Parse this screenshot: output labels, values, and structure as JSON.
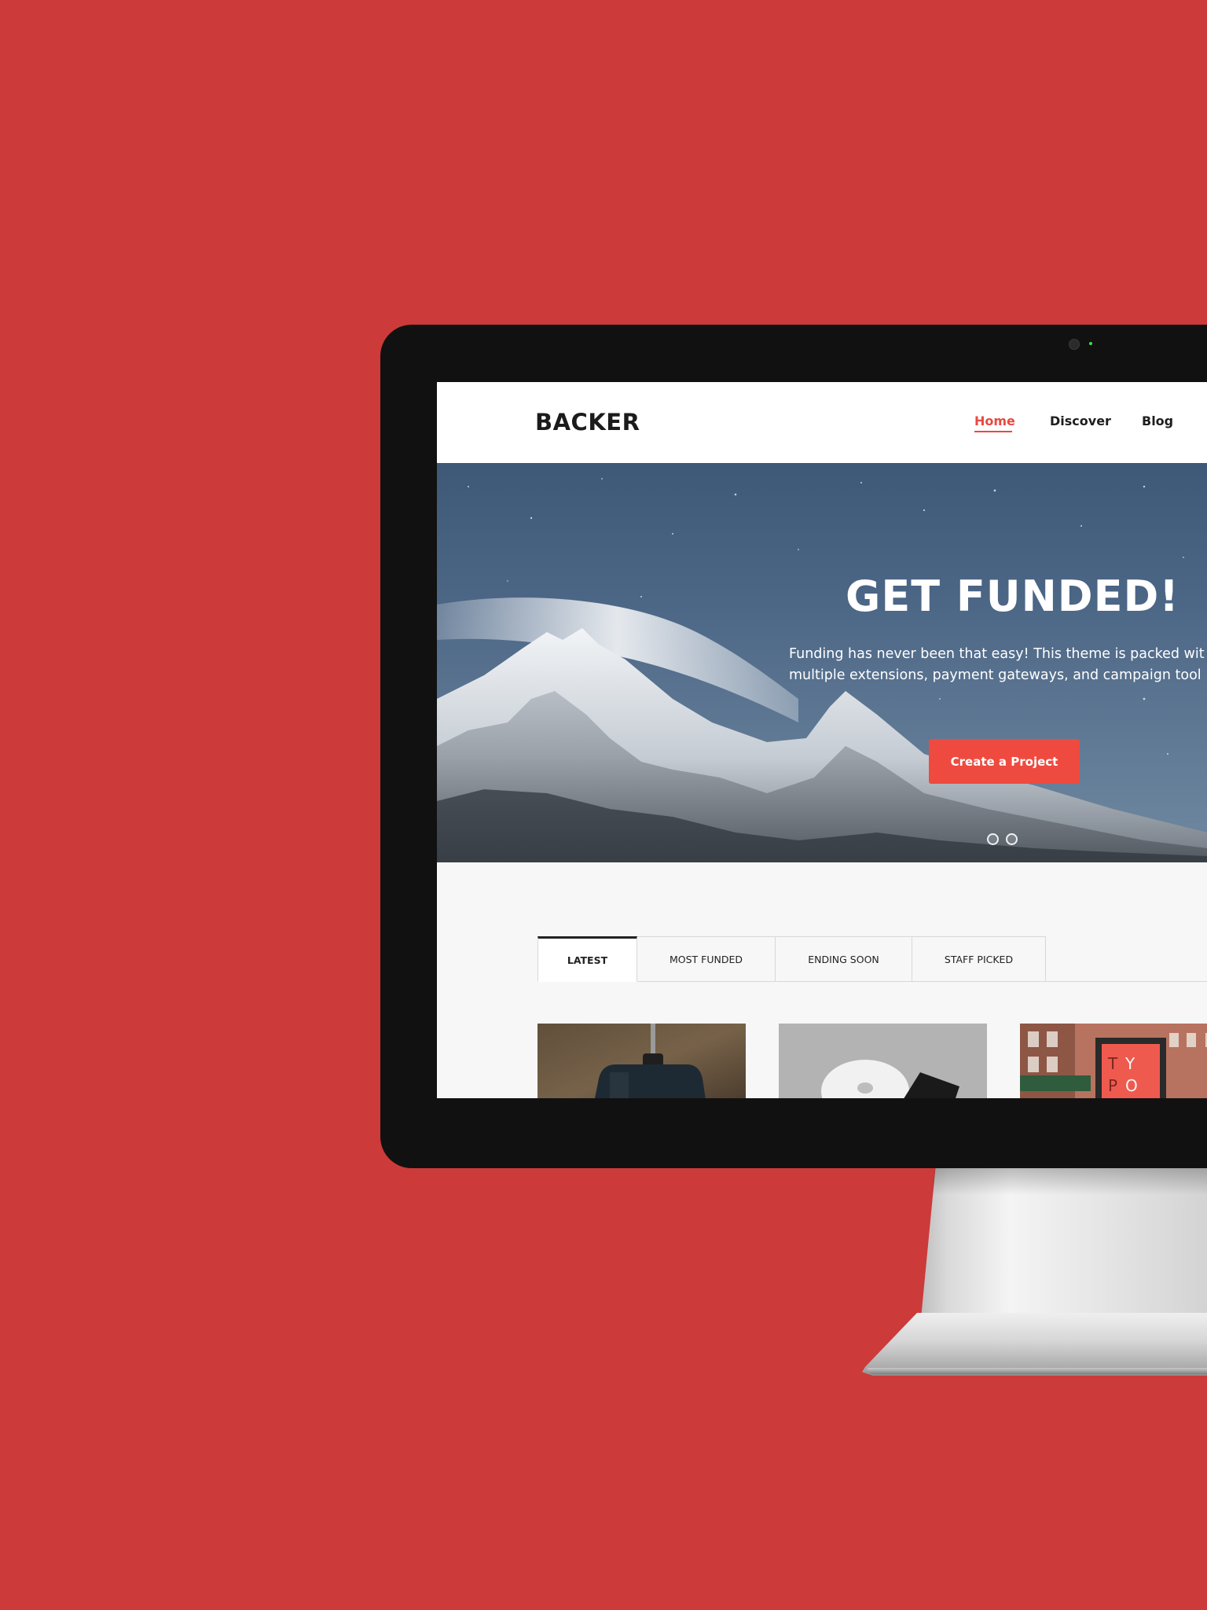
{
  "brand": {
    "logo": "BACKER",
    "background_color": "#cc3a3a",
    "accent_color": "#ef4a3f"
  },
  "nav": {
    "items": [
      {
        "label": "Home",
        "active": true
      },
      {
        "label": "Discover",
        "active": false
      },
      {
        "label": "Blog",
        "active": false
      }
    ]
  },
  "hero": {
    "title": "GET FUNDED!",
    "description_line_1": "Funding has never been that easy! This theme is packed wit",
    "description_line_2": "multiple extensions, payment gateways, and campaign tool",
    "cta_label": "Create a Project",
    "slide_count": 2
  },
  "tabs": [
    {
      "label": "LATEST",
      "active": true
    },
    {
      "label": "MOST FUNDED",
      "active": false
    },
    {
      "label": "ENDING SOON",
      "active": false
    },
    {
      "label": "STAFF PICKED",
      "active": false
    }
  ],
  "cards": [
    {
      "image": "product-bottle-photo"
    },
    {
      "image": "cd-disc-photo"
    },
    {
      "image": "typo-poster-photo",
      "poster_letters": [
        "T",
        "Y",
        "P",
        "O"
      ]
    }
  ]
}
